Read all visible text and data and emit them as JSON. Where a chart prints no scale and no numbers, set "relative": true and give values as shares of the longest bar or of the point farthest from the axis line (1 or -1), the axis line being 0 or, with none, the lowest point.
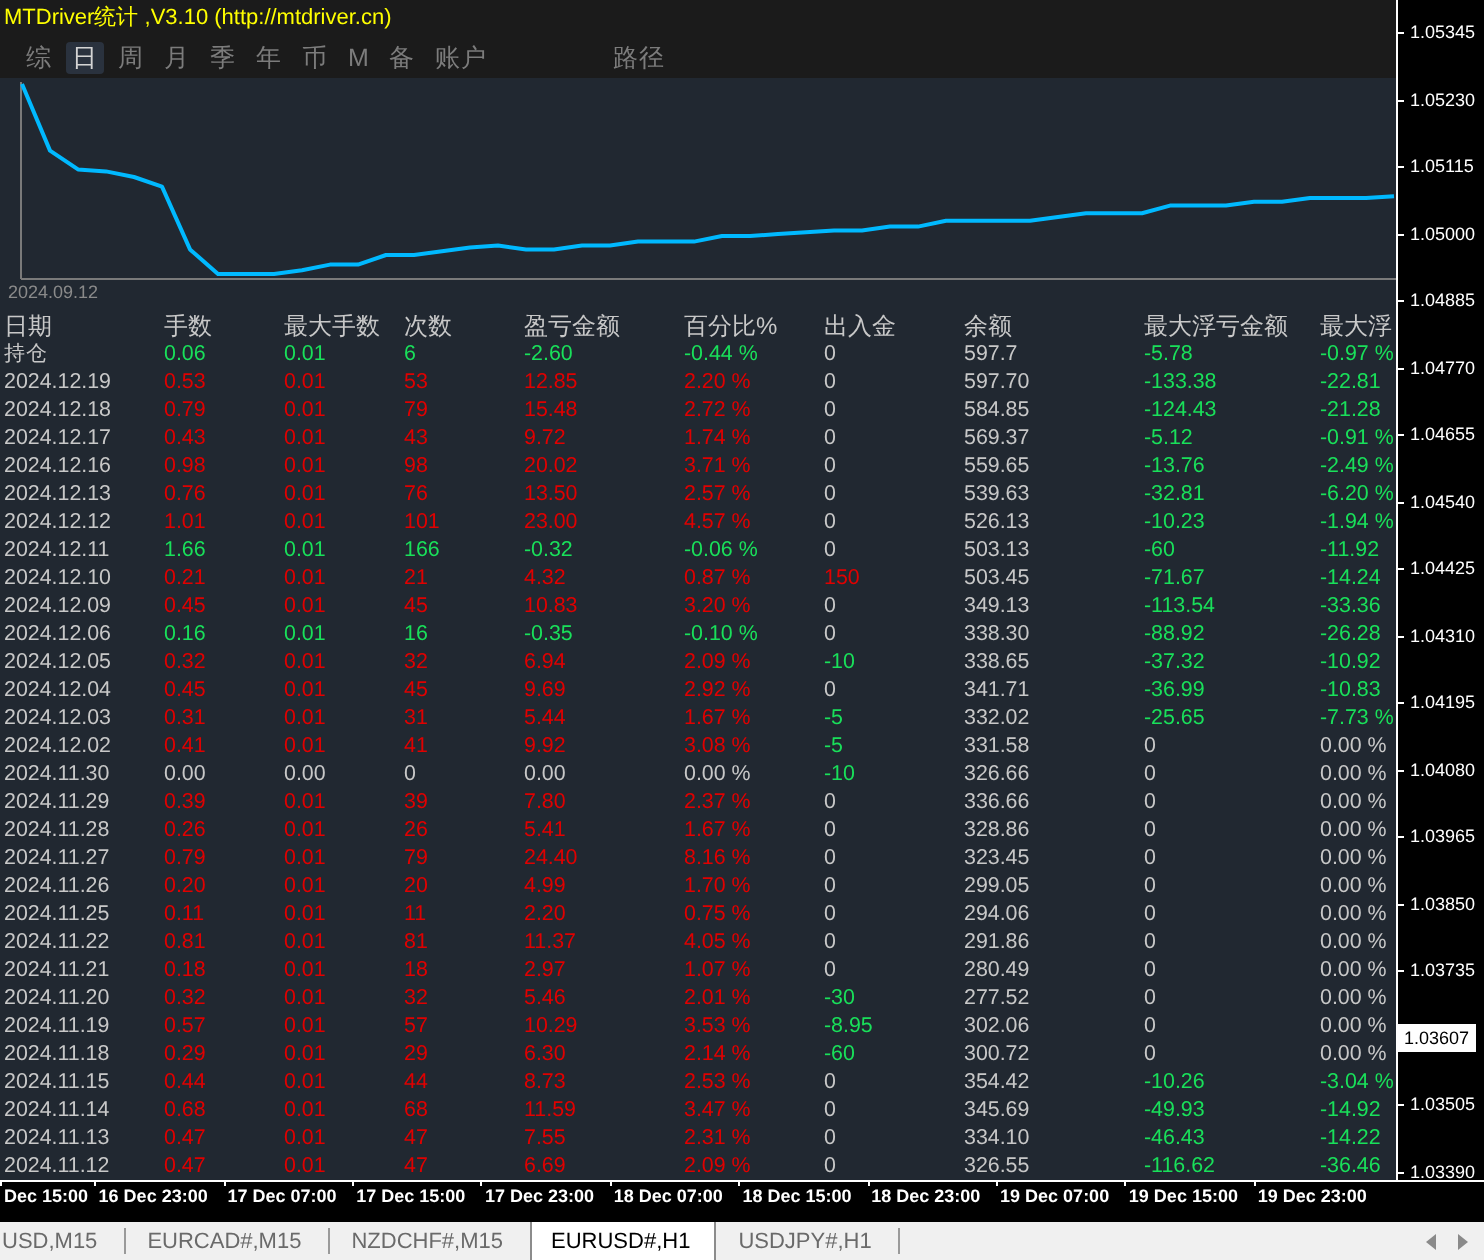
{
  "title": "MTDriver统计 ,V3.10 (http://mtdriver.cn)",
  "tabs": [
    {
      "label": "综",
      "selected": false
    },
    {
      "label": "日",
      "selected": true
    },
    {
      "label": "周",
      "selected": false
    },
    {
      "label": "月",
      "selected": false
    },
    {
      "label": "季",
      "selected": false
    },
    {
      "label": "年",
      "selected": false
    },
    {
      "label": "币",
      "selected": false
    },
    {
      "label": "M",
      "selected": false
    },
    {
      "label": "备",
      "selected": false
    },
    {
      "label": "账户",
      "selected": false
    }
  ],
  "path_button": {
    "label": "路径"
  },
  "chart": {
    "start_label": "2024.09.12",
    "chart_data": {
      "type": "line",
      "relative": true,
      "series": [
        {
          "color": "#00b9ff",
          "values": [
            1.0,
            0.65,
            0.55,
            0.54,
            0.51,
            0.46,
            0.13,
            0.0,
            0.0,
            0.0,
            0.02,
            0.05,
            0.05,
            0.1,
            0.1,
            0.12,
            0.14,
            0.15,
            0.13,
            0.13,
            0.15,
            0.15,
            0.17,
            0.17,
            0.17,
            0.2,
            0.2,
            0.21,
            0.22,
            0.23,
            0.23,
            0.25,
            0.25,
            0.28,
            0.28,
            0.28,
            0.28,
            0.3,
            0.32,
            0.32,
            0.32,
            0.36,
            0.36,
            0.36,
            0.38,
            0.38,
            0.4,
            0.4,
            0.4,
            0.41
          ]
        }
      ]
    }
  },
  "table": {
    "columns": [
      "日期",
      "手数",
      "最大手数",
      "次数",
      "盈亏金额",
      "百分比%",
      "出入金",
      "余额",
      "最大浮亏金额",
      "最大浮"
    ],
    "rows": [
      {
        "period": "持仓",
        "trade": {
          "values": [
            "0.06",
            "0.01",
            "6",
            "-2.60",
            "-0.44 %"
          ],
          "color": "#19e05a"
        },
        "flow": {
          "text": "0",
          "color": "#c8c8c8"
        },
        "balance": "597.7",
        "max_float": {
          "values": [
            "-5.78",
            "-0.97 %"
          ],
          "color": "#19e05a"
        }
      },
      {
        "period": "2024.12.19",
        "trade": {
          "values": [
            "0.53",
            "0.01",
            "53",
            "12.85",
            "2.20 %"
          ],
          "color": "#e00000"
        },
        "flow": {
          "text": "0",
          "color": "#c8c8c8"
        },
        "balance": "597.70",
        "max_float": {
          "values": [
            "-133.38",
            "-22.81"
          ],
          "color": "#19e05a"
        }
      },
      {
        "period": "2024.12.18",
        "trade": {
          "values": [
            "0.79",
            "0.01",
            "79",
            "15.48",
            "2.72 %"
          ],
          "color": "#e00000"
        },
        "flow": {
          "text": "0",
          "color": "#c8c8c8"
        },
        "balance": "584.85",
        "max_float": {
          "values": [
            "-124.43",
            "-21.28"
          ],
          "color": "#19e05a"
        }
      },
      {
        "period": "2024.12.17",
        "trade": {
          "values": [
            "0.43",
            "0.01",
            "43",
            "9.72",
            "1.74 %"
          ],
          "color": "#e00000"
        },
        "flow": {
          "text": "0",
          "color": "#c8c8c8"
        },
        "balance": "569.37",
        "max_float": {
          "values": [
            "-5.12",
            "-0.91 %"
          ],
          "color": "#19e05a"
        }
      },
      {
        "period": "2024.12.16",
        "trade": {
          "values": [
            "0.98",
            "0.01",
            "98",
            "20.02",
            "3.71 %"
          ],
          "color": "#e00000"
        },
        "flow": {
          "text": "0",
          "color": "#c8c8c8"
        },
        "balance": "559.65",
        "max_float": {
          "values": [
            "-13.76",
            "-2.49 %"
          ],
          "color": "#19e05a"
        }
      },
      {
        "period": "2024.12.13",
        "trade": {
          "values": [
            "0.76",
            "0.01",
            "76",
            "13.50",
            "2.57 %"
          ],
          "color": "#e00000"
        },
        "flow": {
          "text": "0",
          "color": "#c8c8c8"
        },
        "balance": "539.63",
        "max_float": {
          "values": [
            "-32.81",
            "-6.20 %"
          ],
          "color": "#19e05a"
        }
      },
      {
        "period": "2024.12.12",
        "trade": {
          "values": [
            "1.01",
            "0.01",
            "101",
            "23.00",
            "4.57 %"
          ],
          "color": "#e00000"
        },
        "flow": {
          "text": "0",
          "color": "#c8c8c8"
        },
        "balance": "526.13",
        "max_float": {
          "values": [
            "-10.23",
            "-1.94 %"
          ],
          "color": "#19e05a"
        }
      },
      {
        "period": "2024.12.11",
        "trade": {
          "values": [
            "1.66",
            "0.01",
            "166",
            "-0.32",
            "-0.06 %"
          ],
          "color": "#19e05a"
        },
        "flow": {
          "text": "0",
          "color": "#c8c8c8"
        },
        "balance": "503.13",
        "max_float": {
          "values": [
            "-60",
            "-11.92"
          ],
          "color": "#19e05a"
        }
      },
      {
        "period": "2024.12.10",
        "trade": {
          "values": [
            "0.21",
            "0.01",
            "21",
            "4.32",
            "0.87 %"
          ],
          "color": "#e00000"
        },
        "flow": {
          "text": "150",
          "color": "#e00000"
        },
        "balance": "503.45",
        "max_float": {
          "values": [
            "-71.67",
            "-14.24"
          ],
          "color": "#19e05a"
        }
      },
      {
        "period": "2024.12.09",
        "trade": {
          "values": [
            "0.45",
            "0.01",
            "45",
            "10.83",
            "3.20 %"
          ],
          "color": "#e00000"
        },
        "flow": {
          "text": "0",
          "color": "#c8c8c8"
        },
        "balance": "349.13",
        "max_float": {
          "values": [
            "-113.54",
            "-33.36"
          ],
          "color": "#19e05a"
        }
      },
      {
        "period": "2024.12.06",
        "trade": {
          "values": [
            "0.16",
            "0.01",
            "16",
            "-0.35",
            "-0.10 %"
          ],
          "color": "#19e05a"
        },
        "flow": {
          "text": "0",
          "color": "#c8c8c8"
        },
        "balance": "338.30",
        "max_float": {
          "values": [
            "-88.92",
            "-26.28"
          ],
          "color": "#19e05a"
        }
      },
      {
        "period": "2024.12.05",
        "trade": {
          "values": [
            "0.32",
            "0.01",
            "32",
            "6.94",
            "2.09 %"
          ],
          "color": "#e00000"
        },
        "flow": {
          "text": "-10",
          "color": "#19e05a"
        },
        "balance": "338.65",
        "max_float": {
          "values": [
            "-37.32",
            "-10.92"
          ],
          "color": "#19e05a"
        }
      },
      {
        "period": "2024.12.04",
        "trade": {
          "values": [
            "0.45",
            "0.01",
            "45",
            "9.69",
            "2.92 %"
          ],
          "color": "#e00000"
        },
        "flow": {
          "text": "0",
          "color": "#c8c8c8"
        },
        "balance": "341.71",
        "max_float": {
          "values": [
            "-36.99",
            "-10.83"
          ],
          "color": "#19e05a"
        }
      },
      {
        "period": "2024.12.03",
        "trade": {
          "values": [
            "0.31",
            "0.01",
            "31",
            "5.44",
            "1.67 %"
          ],
          "color": "#e00000"
        },
        "flow": {
          "text": "-5",
          "color": "#19e05a"
        },
        "balance": "332.02",
        "max_float": {
          "values": [
            "-25.65",
            "-7.73 %"
          ],
          "color": "#19e05a"
        }
      },
      {
        "period": "2024.12.02",
        "trade": {
          "values": [
            "0.41",
            "0.01",
            "41",
            "9.92",
            "3.08 %"
          ],
          "color": "#e00000"
        },
        "flow": {
          "text": "-5",
          "color": "#19e05a"
        },
        "balance": "331.58",
        "max_float": {
          "values": [
            "0",
            "0.00 %"
          ],
          "color": "#c8c8c8"
        }
      },
      {
        "period": "2024.11.30",
        "trade": {
          "values": [
            "0.00",
            "0.00",
            "0",
            "0.00",
            "0.00 %"
          ],
          "color": "#c8c8c8"
        },
        "flow": {
          "text": "-10",
          "color": "#19e05a"
        },
        "balance": "326.66",
        "max_float": {
          "values": [
            "0",
            "0.00 %"
          ],
          "color": "#c8c8c8"
        }
      },
      {
        "period": "2024.11.29",
        "trade": {
          "values": [
            "0.39",
            "0.01",
            "39",
            "7.80",
            "2.37 %"
          ],
          "color": "#e00000"
        },
        "flow": {
          "text": "0",
          "color": "#c8c8c8"
        },
        "balance": "336.66",
        "max_float": {
          "values": [
            "0",
            "0.00 %"
          ],
          "color": "#c8c8c8"
        }
      },
      {
        "period": "2024.11.28",
        "trade": {
          "values": [
            "0.26",
            "0.01",
            "26",
            "5.41",
            "1.67 %"
          ],
          "color": "#e00000"
        },
        "flow": {
          "text": "0",
          "color": "#c8c8c8"
        },
        "balance": "328.86",
        "max_float": {
          "values": [
            "0",
            "0.00 %"
          ],
          "color": "#c8c8c8"
        }
      },
      {
        "period": "2024.11.27",
        "trade": {
          "values": [
            "0.79",
            "0.01",
            "79",
            "24.40",
            "8.16 %"
          ],
          "color": "#e00000"
        },
        "flow": {
          "text": "0",
          "color": "#c8c8c8"
        },
        "balance": "323.45",
        "max_float": {
          "values": [
            "0",
            "0.00 %"
          ],
          "color": "#c8c8c8"
        }
      },
      {
        "period": "2024.11.26",
        "trade": {
          "values": [
            "0.20",
            "0.01",
            "20",
            "4.99",
            "1.70 %"
          ],
          "color": "#e00000"
        },
        "flow": {
          "text": "0",
          "color": "#c8c8c8"
        },
        "balance": "299.05",
        "max_float": {
          "values": [
            "0",
            "0.00 %"
          ],
          "color": "#c8c8c8"
        }
      },
      {
        "period": "2024.11.25",
        "trade": {
          "values": [
            "0.11",
            "0.01",
            "11",
            "2.20",
            "0.75 %"
          ],
          "color": "#e00000"
        },
        "flow": {
          "text": "0",
          "color": "#c8c8c8"
        },
        "balance": "294.06",
        "max_float": {
          "values": [
            "0",
            "0.00 %"
          ],
          "color": "#c8c8c8"
        }
      },
      {
        "period": "2024.11.22",
        "trade": {
          "values": [
            "0.81",
            "0.01",
            "81",
            "11.37",
            "4.05 %"
          ],
          "color": "#e00000"
        },
        "flow": {
          "text": "0",
          "color": "#c8c8c8"
        },
        "balance": "291.86",
        "max_float": {
          "values": [
            "0",
            "0.00 %"
          ],
          "color": "#c8c8c8"
        }
      },
      {
        "period": "2024.11.21",
        "trade": {
          "values": [
            "0.18",
            "0.01",
            "18",
            "2.97",
            "1.07 %"
          ],
          "color": "#e00000"
        },
        "flow": {
          "text": "0",
          "color": "#c8c8c8"
        },
        "balance": "280.49",
        "max_float": {
          "values": [
            "0",
            "0.00 %"
          ],
          "color": "#c8c8c8"
        }
      },
      {
        "period": "2024.11.20",
        "trade": {
          "values": [
            "0.32",
            "0.01",
            "32",
            "5.46",
            "2.01 %"
          ],
          "color": "#e00000"
        },
        "flow": {
          "text": "-30",
          "color": "#19e05a"
        },
        "balance": "277.52",
        "max_float": {
          "values": [
            "0",
            "0.00 %"
          ],
          "color": "#c8c8c8"
        }
      },
      {
        "period": "2024.11.19",
        "trade": {
          "values": [
            "0.57",
            "0.01",
            "57",
            "10.29",
            "3.53 %"
          ],
          "color": "#e00000"
        },
        "flow": {
          "text": "-8.95",
          "color": "#19e05a"
        },
        "balance": "302.06",
        "max_float": {
          "values": [
            "0",
            "0.00 %"
          ],
          "color": "#c8c8c8"
        }
      },
      {
        "period": "2024.11.18",
        "trade": {
          "values": [
            "0.29",
            "0.01",
            "29",
            "6.30",
            "2.14 %"
          ],
          "color": "#e00000"
        },
        "flow": {
          "text": "-60",
          "color": "#19e05a"
        },
        "balance": "300.72",
        "max_float": {
          "values": [
            "0",
            "0.00 %"
          ],
          "color": "#c8c8c8"
        }
      },
      {
        "period": "2024.11.15",
        "trade": {
          "values": [
            "0.44",
            "0.01",
            "44",
            "8.73",
            "2.53 %"
          ],
          "color": "#e00000"
        },
        "flow": {
          "text": "0",
          "color": "#c8c8c8"
        },
        "balance": "354.42",
        "max_float": {
          "values": [
            "-10.26",
            "-3.04 %"
          ],
          "color": "#19e05a"
        }
      },
      {
        "period": "2024.11.14",
        "trade": {
          "values": [
            "0.68",
            "0.01",
            "68",
            "11.59",
            "3.47 %"
          ],
          "color": "#e00000"
        },
        "flow": {
          "text": "0",
          "color": "#c8c8c8"
        },
        "balance": "345.69",
        "max_float": {
          "values": [
            "-49.93",
            "-14.92"
          ],
          "color": "#19e05a"
        }
      },
      {
        "period": "2024.11.13",
        "trade": {
          "values": [
            "0.47",
            "0.01",
            "47",
            "7.55",
            "2.31 %"
          ],
          "color": "#e00000"
        },
        "flow": {
          "text": "0",
          "color": "#c8c8c8"
        },
        "balance": "334.10",
        "max_float": {
          "values": [
            "-46.43",
            "-14.22"
          ],
          "color": "#19e05a"
        }
      },
      {
        "period": "2024.11.12",
        "trade": {
          "values": [
            "0.47",
            "0.01",
            "47",
            "6.69",
            "2.09 %"
          ],
          "color": "#e00000"
        },
        "flow": {
          "text": "0",
          "color": "#c8c8c8"
        },
        "balance": "326.55",
        "max_float": {
          "values": [
            "-116.62",
            "-36.46"
          ],
          "color": "#19e05a"
        }
      }
    ]
  },
  "price_axis": [
    {
      "label": "1.05345",
      "kind": "tick"
    },
    {
      "label": "1.05230",
      "kind": "tick"
    },
    {
      "label": "1.05115",
      "kind": "tick"
    },
    {
      "label": "1.05000",
      "kind": "tick"
    },
    {
      "label": "1.04885",
      "kind": "tick"
    },
    {
      "label": "1.04770",
      "kind": "tick"
    },
    {
      "label": "1.04655",
      "kind": "tick"
    },
    {
      "label": "1.04540",
      "kind": "tick"
    },
    {
      "label": "1.04425",
      "kind": "tick"
    },
    {
      "label": "1.04310",
      "kind": "tick"
    },
    {
      "label": "1.04195",
      "kind": "tick"
    },
    {
      "label": "1.04080",
      "kind": "tick"
    },
    {
      "label": "1.03965",
      "kind": "tick"
    },
    {
      "label": "1.03850",
      "kind": "tick"
    },
    {
      "label": "1.03735",
      "kind": "tick"
    },
    {
      "label": "1.03607",
      "kind": "current"
    },
    {
      "label": "1.03505",
      "kind": "tick"
    },
    {
      "label": "1.03390",
      "kind": "tick"
    }
  ],
  "time_axis": [
    "Dec 15:00",
    "16 Dec 23:00",
    "17 Dec 07:00",
    "17 Dec 15:00",
    "17 Dec 23:00",
    "18 Dec 07:00",
    "18 Dec 15:00",
    "18 Dec 23:00",
    "19 Dec 07:00",
    "19 Dec 15:00",
    "19 Dec 23:00"
  ],
  "symbol_tabs": [
    {
      "label": "USD,M15",
      "selected": false
    },
    {
      "label": "EURCAD#,M15",
      "selected": false
    },
    {
      "label": "NZDCHF#,M15",
      "selected": false
    },
    {
      "label": "EURUSD#,H1",
      "selected": true
    },
    {
      "label": "USDJPY#,H1",
      "selected": false
    }
  ]
}
